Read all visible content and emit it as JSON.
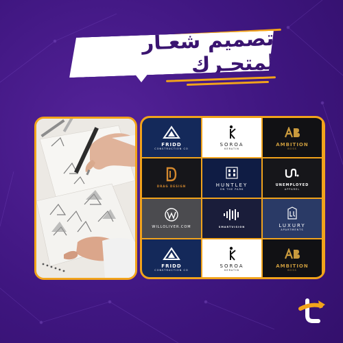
{
  "banner": {
    "title": "تصميم شعـار لمتجـرك"
  },
  "logos": [
    {
      "name": "FRIDD",
      "sub": "CONSTRUCTION CO",
      "icon": "triangle-mountain-icon"
    },
    {
      "name": "SOROA",
      "sub": "KERATIN",
      "icon": "figure-k-icon"
    },
    {
      "name": "AMBITION",
      "sub": "BOSS",
      "icon": "ab-monogram-icon"
    },
    {
      "name": "DRAG DESIGN",
      "sub": "",
      "icon": "d-monogram-icon"
    },
    {
      "name": "HUNTLEY",
      "sub": "ON THE PARK",
      "icon": "building-crest-icon"
    },
    {
      "name": "UNEMPLOYED",
      "sub": "APPAREL",
      "icon": "u-wave-icon"
    },
    {
      "name": "WILLOLIVER.COM",
      "sub": "",
      "icon": "w-circle-icon"
    },
    {
      "name": "SMARTVISION",
      "sub": "",
      "icon": "waveform-icon"
    },
    {
      "name": "LUXURY",
      "sub": "APARTMENTS",
      "icon": "lu-crest-icon"
    },
    {
      "name": "FRIDD",
      "sub": "CONSTRUCTION CO",
      "icon": "triangle-mountain-icon"
    },
    {
      "name": "SOROA",
      "sub": "KERATIN",
      "icon": "figure-k-icon"
    },
    {
      "name": "AMBITION",
      "sub": "BOSS",
      "icon": "ab-monogram-icon"
    }
  ],
  "colors": {
    "background": "#3f1680",
    "accent": "#f2a31b",
    "banner": "#ffffff",
    "title": "#3a1470"
  }
}
